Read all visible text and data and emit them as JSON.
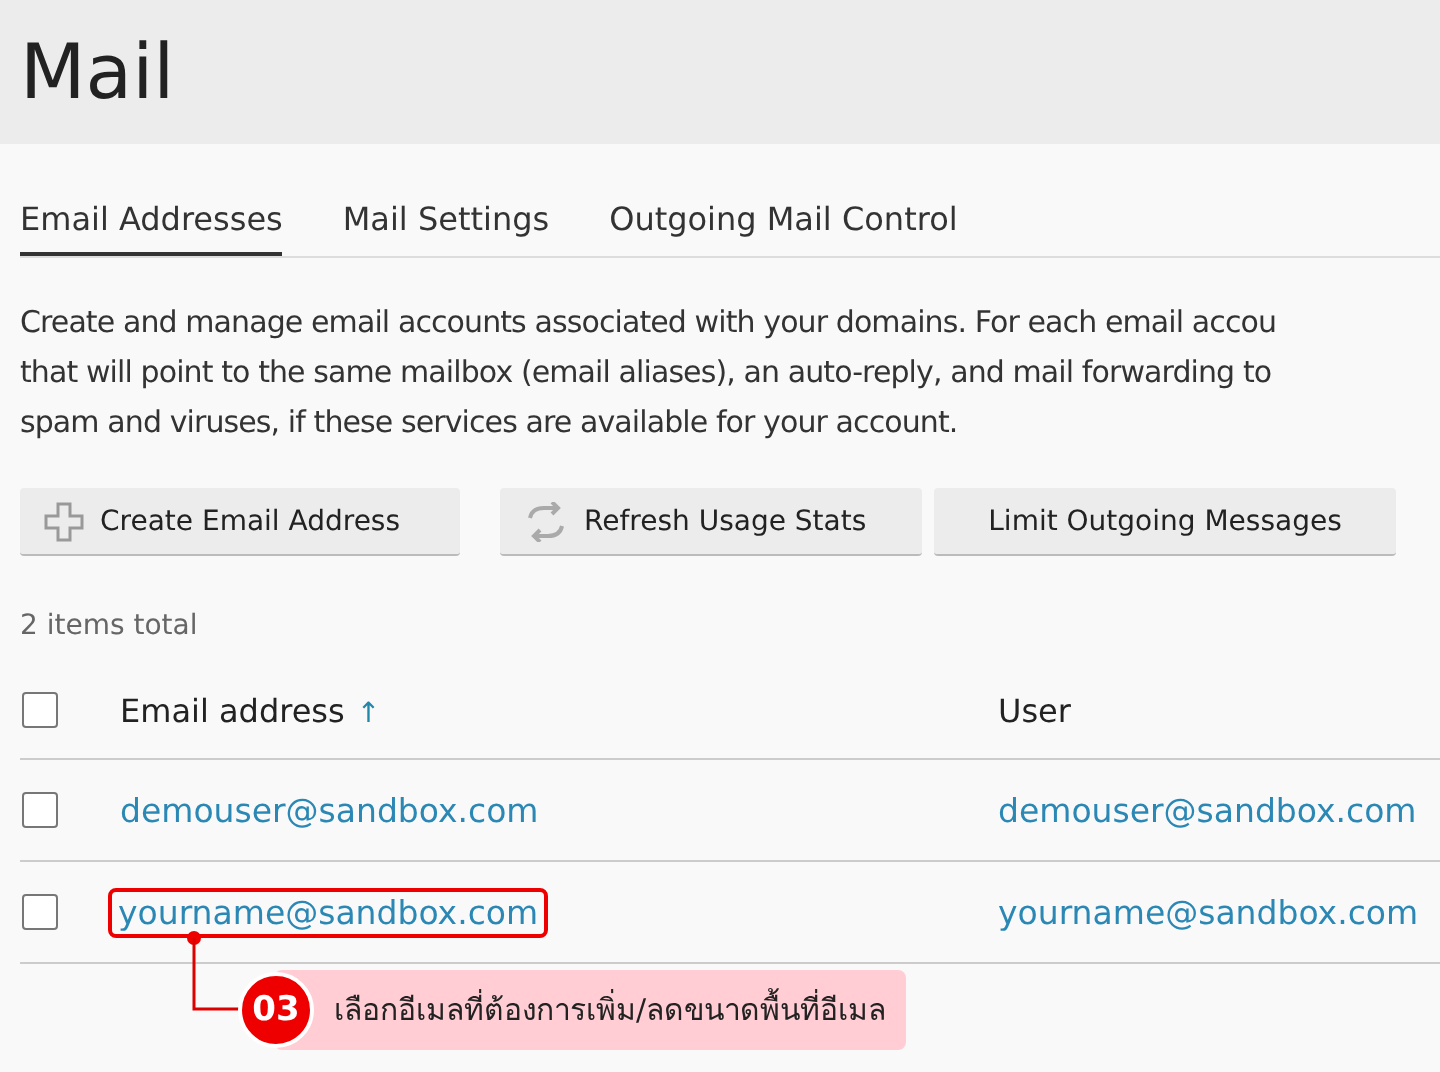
{
  "page_title": "Mail",
  "tabs": [
    {
      "label": "Email Addresses",
      "selected": true
    },
    {
      "label": "Mail Settings",
      "selected": false
    },
    {
      "label": "Outgoing Mail Control",
      "selected": false
    }
  ],
  "description_lines": [
    "Create and manage email accounts associated with your domains. For each email accou",
    "that will point to the same mailbox (email aliases), an auto-reply, and mail forwarding to",
    "spam and viruses, if these services are available for your account."
  ],
  "buttons": [
    {
      "label": "Create Email Address",
      "kind": "plus"
    },
    {
      "label": "Refresh Usage Stats",
      "kind": "refresh"
    },
    {
      "label": "Limit Outgoing Messages",
      "kind": "plain"
    }
  ],
  "items_total": "2 items total",
  "table": {
    "select_all_checked": false,
    "columns": [
      {
        "label": "Email address",
        "sort_indicator": "↑"
      },
      {
        "label": "User"
      }
    ],
    "rows": [
      {
        "checked": false,
        "highlighted": false,
        "email": "demouser@sandbox.com",
        "user": "demouser@sandbox.com"
      },
      {
        "checked": false,
        "highlighted": true,
        "email": "yourname@sandbox.com",
        "user": "yourname@sandbox.com"
      }
    ]
  },
  "callout": {
    "number": "03",
    "text": "เลือกอีเมลที่ต้องการเพิ่ม/ลดขนาดพื้นที่อีเมล"
  }
}
